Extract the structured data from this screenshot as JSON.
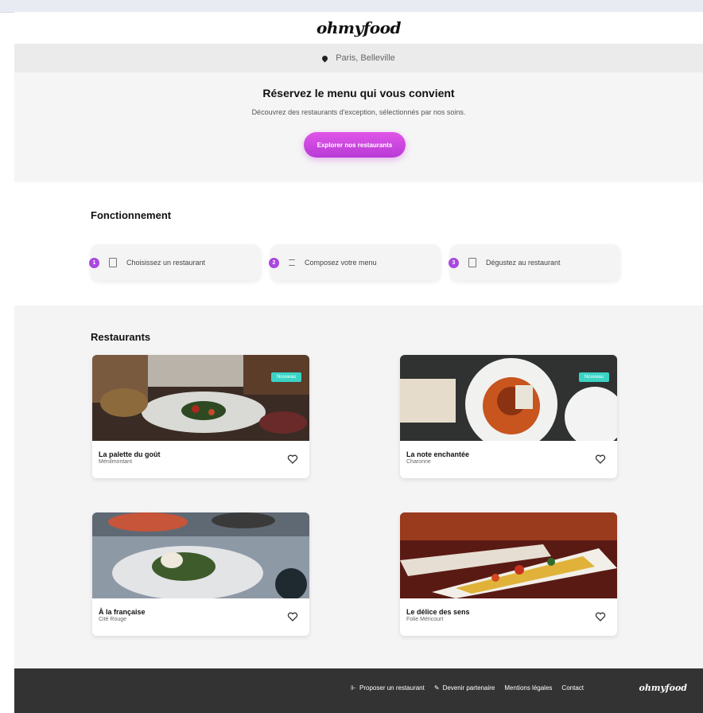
{
  "brand": {
    "logo": "ohmyfood"
  },
  "location": {
    "text": "Paris, Belleville",
    "icon": "location-pin-icon"
  },
  "hero": {
    "title": "Réservez le menu qui vous convient",
    "subtitle": "Découvrez des restaurants d'exception, sélectionnés par nos soins.",
    "cta_label": "Explorer nos restaurants"
  },
  "how": {
    "title": "Fonctionnement",
    "steps": [
      {
        "num": "1",
        "label": "Choisissez un restaurant",
        "icon": "phone-icon"
      },
      {
        "num": "2",
        "label": "Composez votre menu",
        "icon": "list-icon"
      },
      {
        "num": "3",
        "label": "Dégustez au restaurant",
        "icon": "calendar-icon"
      }
    ]
  },
  "restaurants": {
    "title": "Restaurants",
    "items": [
      {
        "name": "La palette du goût",
        "area": "Ménilmontant",
        "badge": "Nouveau"
      },
      {
        "name": "La note enchantée",
        "area": "Charonne",
        "badge": "Nouveau"
      },
      {
        "name": "À la française",
        "area": "Cité Rouge",
        "badge": ""
      },
      {
        "name": "Le délice des sens",
        "area": "Folie Méricourt",
        "badge": ""
      }
    ]
  },
  "footer": {
    "link1": "Proposer un restaurant",
    "link2": "Devenir partenaire",
    "link3": "Mentions légales",
    "link4": "Contact",
    "logo": "ohmyfood"
  }
}
